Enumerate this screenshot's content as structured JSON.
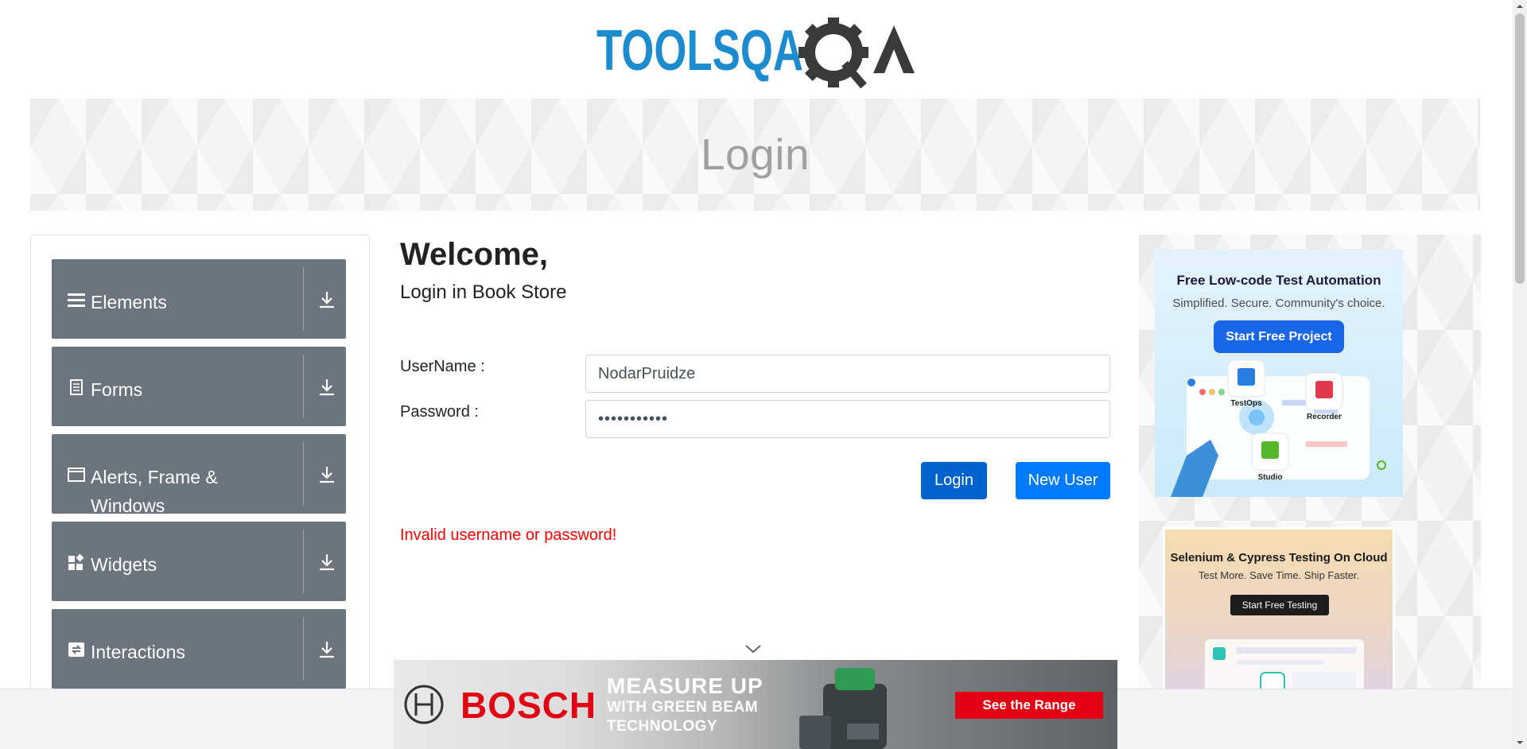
{
  "header": {
    "logo_text": "TOOLSQA"
  },
  "banner": {
    "title": "Login"
  },
  "sidebar": {
    "groups": [
      {
        "label": "Elements",
        "icon": "menu-icon"
      },
      {
        "label": "Forms",
        "icon": "document-icon"
      },
      {
        "label": "Alerts, Frame & Windows",
        "icon": "window-icon"
      },
      {
        "label": "Widgets",
        "icon": "widgets-icon"
      },
      {
        "label": "Interactions",
        "icon": "swap-icon"
      }
    ]
  },
  "main": {
    "welcome": "Welcome,",
    "subtitle": "Login in Book Store",
    "username_label": "UserName :",
    "username_value": "NodarPruidze",
    "password_label": "Password :",
    "password_value": "•••••••••••",
    "login_button": "Login",
    "new_user_button": "New User",
    "error": "Invalid username or password!"
  },
  "ads": {
    "ad1": {
      "title": "Free Low-code Test Automation",
      "subtitle": "Simplified. Secure. Community's choice.",
      "cta": "Start Free Project",
      "labels": [
        "TestOps",
        "Recorder",
        "Studio"
      ]
    },
    "ad2": {
      "title": "Selenium & Cypress Testing On Cloud",
      "subtitle": "Test More. Save Time. Ship Faster.",
      "cta": "Start Free Testing"
    },
    "bottom": {
      "brand": "BOSCH",
      "headline1": "MEASURE UP",
      "headline2": "WITH GREEN BEAM",
      "headline3": "TECHNOLOGY",
      "cta": "See the Range"
    }
  },
  "colors": {
    "primary_button": "#0062cc",
    "secondary_button": "#007bff",
    "sidebar_group": "#6c757d",
    "error": "#ff0000",
    "logo_blue": "#1d8ccf",
    "logo_dark": "#3a3a3a"
  }
}
